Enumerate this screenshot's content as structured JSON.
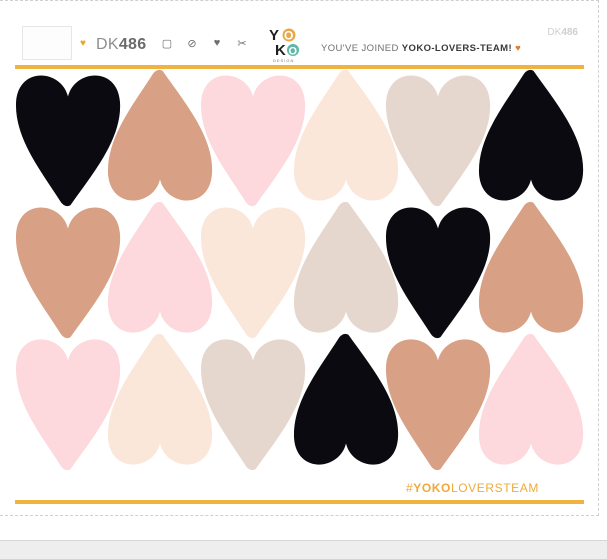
{
  "header": {
    "code_prefix": "DK",
    "code_number": "486",
    "joined_prefix": "YOU'VE JOINED ",
    "joined_team": "YOKO-LOVERS-TEAM!",
    "joined_heart": "♥",
    "corner_code_prefix": "DK",
    "corner_code_number": "486",
    "logo_letters": [
      "Y",
      "O",
      "K",
      "O"
    ],
    "logo_sub": "DESIGN"
  },
  "icons": [
    "heart-icon",
    "rotate-icon",
    "leaf-icon",
    "heart-icon",
    "scissors-icon"
  ],
  "footer": {
    "hashtag_hash": "#",
    "hashtag_bold": "YOKO",
    "hashtag_rest": "LOVERSTEAM"
  },
  "colors": {
    "black": "#0b0a10",
    "caramel": "#d8a085",
    "pink": "#fdd9dd",
    "cream": "#fbe7d9",
    "greige": "#e6d7ce",
    "accent": "#f0b33f"
  },
  "hearts": [
    [
      "black",
      "caramel",
      "pink",
      "cream",
      "greige",
      "black"
    ],
    [
      "caramel",
      "pink",
      "cream",
      "greige",
      "black",
      "caramel"
    ],
    [
      "pink",
      "cream",
      "greige",
      "black",
      "caramel",
      "pink"
    ]
  ],
  "heart_orientation": [
    [
      "up",
      "down",
      "up",
      "down",
      "up",
      "down"
    ],
    [
      "up",
      "down",
      "up",
      "down",
      "up",
      "down"
    ],
    [
      "up",
      "down",
      "up",
      "down",
      "up",
      "down"
    ]
  ]
}
